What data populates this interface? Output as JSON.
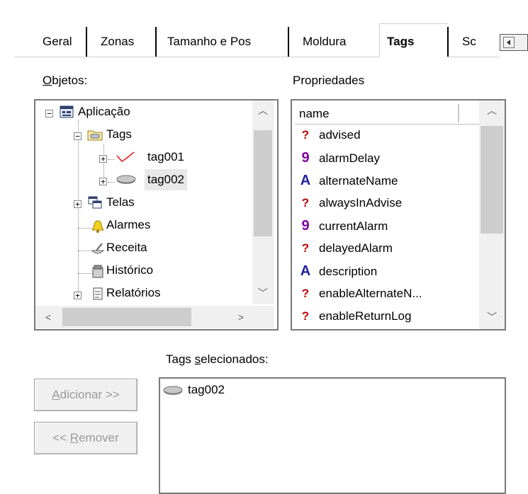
{
  "tabs": [
    {
      "label": "Geral"
    },
    {
      "label": "Zonas"
    },
    {
      "label": "Tamanho e Pos"
    },
    {
      "label": "Moldura"
    },
    {
      "label": "Tags"
    },
    {
      "label": "Sc"
    }
  ],
  "objects_panel": {
    "label_first": "O",
    "label_rest": "bjetos:",
    "tree": [
      {
        "label": "Aplicação",
        "icon": "application-icon"
      },
      {
        "label": "Tags",
        "icon": "tags-folder-icon"
      },
      {
        "label": "tag001",
        "icon": "trend-tag-icon"
      },
      {
        "label": "tag002",
        "icon": "disk-tag-icon"
      },
      {
        "label": "Telas",
        "icon": "screens-icon"
      },
      {
        "label": "Alarmes",
        "icon": "alarm-bell-icon"
      },
      {
        "label": "Receita",
        "icon": "recipe-icon"
      },
      {
        "label": "Histórico",
        "icon": "historic-icon"
      },
      {
        "label": "Relatórios",
        "icon": "reports-icon"
      }
    ]
  },
  "properties_panel": {
    "label": "Propriedades",
    "column_header": "name",
    "items": [
      {
        "type": "?",
        "name": "advised"
      },
      {
        "type": "9",
        "name": "alarmDelay"
      },
      {
        "type": "A",
        "name": "alternateName"
      },
      {
        "type": "?",
        "name": "alwaysInAdvise"
      },
      {
        "type": "9",
        "name": "currentAlarm"
      },
      {
        "type": "?",
        "name": "delayedAlarm"
      },
      {
        "type": "A",
        "name": "description"
      },
      {
        "type": "?",
        "name": "enableAlternateN..."
      },
      {
        "type": "?",
        "name": "enableReturnLog"
      }
    ]
  },
  "selected_tags": {
    "label_pre": "Tags ",
    "label_u": "s",
    "label_post": "elecionados:",
    "items": [
      {
        "label": "tag002",
        "icon": "disk-tag-icon"
      }
    ]
  },
  "buttons": {
    "add_u": "A",
    "add_rest": "dicionar >>",
    "remove_pre": "<< ",
    "remove_u": "R",
    "remove_rest": "emover"
  },
  "colors": {
    "background": "#ffffff",
    "panel_border": "#7a7a7a",
    "scrollbar": "#f0f0f0",
    "disabled_text": "#9a9a9a"
  }
}
